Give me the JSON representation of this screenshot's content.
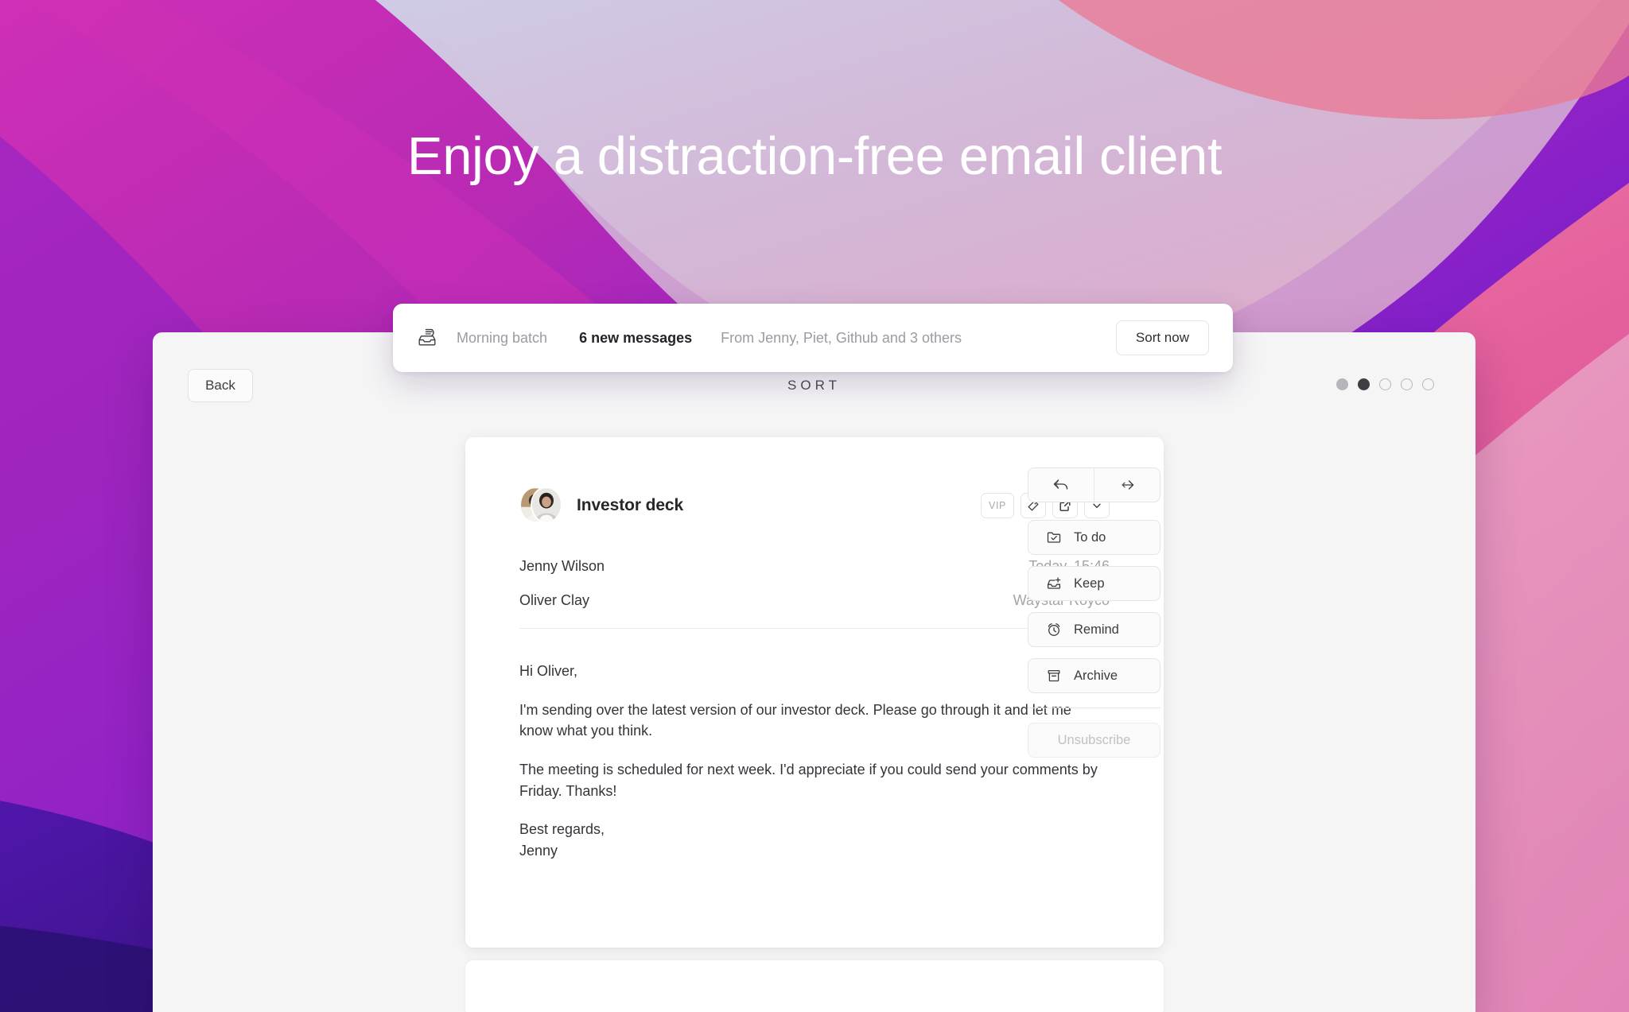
{
  "hero": {
    "headline": "Enjoy a distraction-free email client",
    "colors": {
      "magenta": "#c42bb0",
      "purple": "#7a1fd0",
      "deep_indigo": "#3a1396",
      "pink": "#e0609f",
      "lavender": "#c9c2e0",
      "soft_pink": "#e8a8c6"
    }
  },
  "notification": {
    "icon": "inbox-batch-icon",
    "batch_label": "Morning batch",
    "count_label": "6 new messages",
    "from_label": "From Jenny, Piet, Github and 3 others",
    "sort_button": "Sort now"
  },
  "app": {
    "back_button": "Back",
    "title": "SORT",
    "pagination": {
      "dots": [
        {
          "state": "filled-light"
        },
        {
          "state": "filled-dark"
        },
        {
          "state": "hollow"
        },
        {
          "state": "hollow"
        },
        {
          "state": "hollow"
        }
      ]
    }
  },
  "mail": {
    "subject": "Investor deck",
    "avatar": "group-avatar",
    "header_actions": [
      {
        "name": "vip-badge",
        "label": "VIP"
      },
      {
        "name": "tag-icon",
        "label": ""
      },
      {
        "name": "open-external-icon",
        "label": ""
      },
      {
        "name": "chevron-down-icon",
        "label": ""
      }
    ],
    "meta": [
      {
        "left": "Jenny Wilson",
        "right": "Today, 15:46"
      },
      {
        "left": "Oliver Clay",
        "right": "Waystar Royco"
      }
    ],
    "body": [
      "Hi Oliver,",
      "I'm sending over the latest version of our investor deck. Please go through it and let me know what you think.",
      "The meeting is scheduled for next week. I'd appreciate if you could send your comments by Friday. Thanks!",
      "Best regards,\nJenny"
    ]
  },
  "rail": {
    "reply_label": "Reply",
    "forward_label": "Forward",
    "actions": [
      {
        "icon": "folder-check-icon",
        "label": "To do"
      },
      {
        "icon": "inbox-plus-icon",
        "label": "Keep"
      },
      {
        "icon": "alarm-clock-icon",
        "label": "Remind"
      },
      {
        "icon": "archive-box-icon",
        "label": "Archive"
      }
    ],
    "unsubscribe_label": "Unsubscribe"
  }
}
